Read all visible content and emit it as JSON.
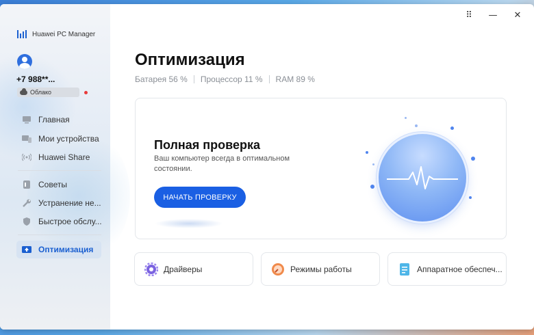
{
  "app": {
    "name": "Huawei PC Manager"
  },
  "account": {
    "phone": "+7 988**...",
    "cloud_label": "Облако"
  },
  "sidebar": {
    "items": [
      {
        "label": "Главная"
      },
      {
        "label": "Мои устройства"
      },
      {
        "label": "Huawei Share"
      },
      {
        "label": "Советы"
      },
      {
        "label": "Устранение не..."
      },
      {
        "label": "Быстрое обслу..."
      },
      {
        "label": "Оптимизация"
      }
    ],
    "active_index": 6
  },
  "window_controls": {
    "more": "⠿",
    "minimize": "—",
    "close": "✕"
  },
  "main": {
    "title": "Оптимизация",
    "stats": {
      "battery": "Батарея 56 %",
      "cpu": "Процессор 11 %",
      "ram": "RAM 89 %"
    },
    "scan": {
      "title": "Полная проверка",
      "description": "Ваш компьютер всегда в оптимальном состоянии.",
      "button_label": "НАЧАТЬ ПРОВЕРКУ"
    },
    "tiles": [
      {
        "label": "Драйверы",
        "icon": "gear-icon"
      },
      {
        "label": "Режимы работы",
        "icon": "speedometer-icon"
      },
      {
        "label": "Аппаратное обеспеч...",
        "icon": "document-icon"
      }
    ]
  },
  "colors": {
    "accent": "#1a5fe3",
    "active_nav": "#1a5fd0",
    "badge_dot": "#e83a3a"
  }
}
